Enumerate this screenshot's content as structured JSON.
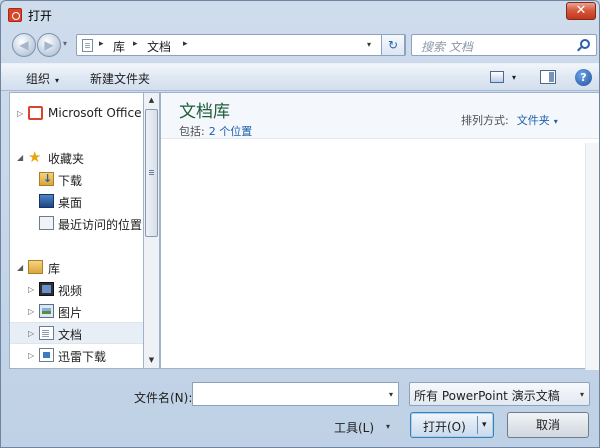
{
  "window": {
    "title": "打开",
    "close_glyph": "✕"
  },
  "nav": {
    "back_glyph": "◀",
    "forward_glyph": "▶",
    "history_glyph": "▾",
    "breadcrumbs": [
      "库",
      "文档"
    ],
    "breadcrumb_separator": "▸",
    "address_dropdown_glyph": "▾",
    "refresh_glyph": "↻",
    "search_placeholder": "搜索 文档"
  },
  "toolbar": {
    "organize_label": "组织",
    "organize_caret": "▾",
    "new_folder_label": "新建文件夹",
    "view_caret": "▾",
    "help_glyph": "?"
  },
  "sidebar": {
    "items": [
      {
        "label": "Microsoft Office",
        "icon": "office-icon",
        "expander": "▷"
      },
      {
        "label": "收藏夹",
        "icon": "favorites-star-icon",
        "expander": "◢"
      },
      {
        "label": "下载",
        "icon": "downloads-icon",
        "expander": ""
      },
      {
        "label": "桌面",
        "icon": "desktop-icon",
        "expander": ""
      },
      {
        "label": "最近访问的位置",
        "icon": "recent-places-icon",
        "expander": ""
      },
      {
        "label": "库",
        "icon": "library-icon",
        "expander": "◢"
      },
      {
        "label": "视频",
        "icon": "videos-icon",
        "expander": "▷"
      },
      {
        "label": "图片",
        "icon": "pictures-icon",
        "expander": "▷"
      },
      {
        "label": "文档",
        "icon": "documents-icon",
        "expander": "▷",
        "selected": true
      },
      {
        "label": "迅雷下载",
        "icon": "thunder-download-icon",
        "expander": "▷"
      }
    ],
    "scroll_up_glyph": "▲",
    "scroll_down_glyph": "▼"
  },
  "content": {
    "library_title": "文档库",
    "includes_label": "包括:",
    "includes_value": "2 个位置",
    "arrange_label": "排列方式:",
    "arrange_value": "文件夹",
    "arrange_caret": "▾"
  },
  "footer": {
    "filename_label": "文件名(N):",
    "filename_value": "",
    "filename_caret": "▾",
    "filter_value": "所有 PowerPoint 演示文稿",
    "filter_caret": "▾",
    "tools_label": "工具(L)",
    "tools_caret": "▾",
    "open_label": "打开(O)",
    "open_caret": "▾",
    "cancel_label": "取消"
  },
  "colors": {
    "accent": "#1e5fae",
    "library_title": "#1e5b3a",
    "close_button": "#c4361a"
  }
}
